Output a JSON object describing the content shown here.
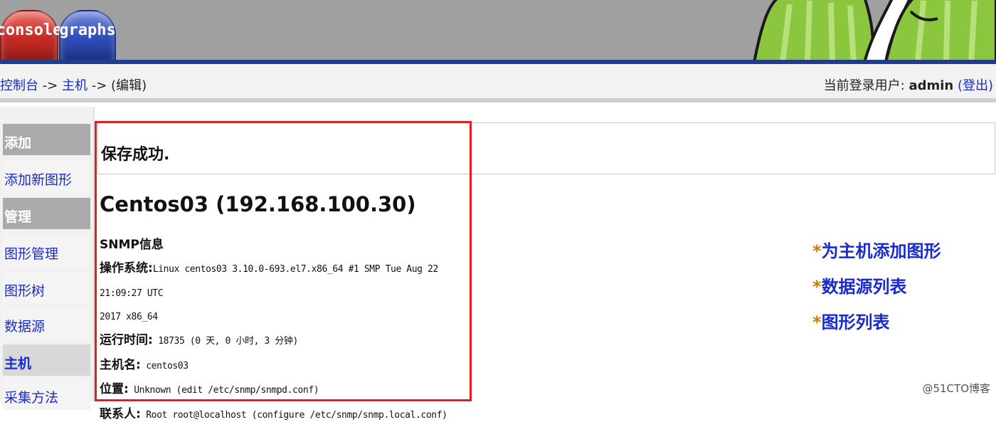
{
  "tabs": {
    "console": "console",
    "graphs": "graphs"
  },
  "breadcrumb": {
    "console": "控制台",
    "sep1": " -> ",
    "hosts": "主机",
    "sep2": " -> (编辑)"
  },
  "login": {
    "prefix": "当前登录用户: ",
    "user": "admin",
    "logout": "(登出)"
  },
  "menu": {
    "add_head": "添加",
    "add_graph": "添加新图形",
    "manage_head": "管理",
    "graph_mgmt": "图形管理",
    "graph_tree": "图形树",
    "data_sources": "数据源",
    "hosts": "主机",
    "collection_methods": "采集方法"
  },
  "message": "保存成功.",
  "host": {
    "title": "Centos03 (192.168.100.30)",
    "snmp_heading": "SNMP信息",
    "os_label": "操作系统:",
    "os_value_line1": "Linux centos03 3.10.0-693.el7.x86_64 #1 SMP Tue Aug 22 21:09:27 UTC",
    "os_value_line2": "2017 x86_64",
    "uptime_label": "运行时间:",
    "uptime_value": " 18735 (0 天, 0 小时, 3 分钟)",
    "hostname_label": "主机名:",
    "hostname_value": " centos03",
    "location_label": "位置:",
    "location_value": " Unknown (edit /etc/snmp/snmpd.conf)",
    "contact_label": "联系人:",
    "contact_value": " Root root@localhost (configure /etc/snmp/snmp.local.conf)"
  },
  "actions": {
    "star": "*",
    "add_graphs": "为主机添加图形",
    "data_source_list": "数据源列表",
    "graph_list": "图形列表"
  },
  "watermark": "@51CTO博客",
  "colors": {
    "link": "#1a2cc8",
    "highlight_box": "#e02020",
    "banner": "#203c8c"
  }
}
